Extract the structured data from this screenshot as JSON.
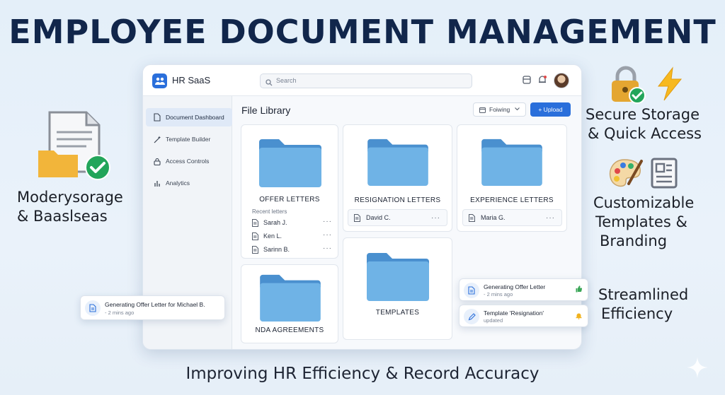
{
  "headline": "EMPLOYEE DOCUMENT MANAGEMENT",
  "footer": "Improving HR Efficiency & Record Accuracy",
  "left_feature": {
    "line1": "Moderysorage",
    "line2": "& Baaslseas"
  },
  "right_features": [
    {
      "line1": "Secure Storage",
      "line2": "& Quick Access"
    },
    {
      "line1": "Customizable",
      "line2": "Templates &",
      "line3": "Branding"
    },
    {
      "line1": "Streamlined",
      "line2": "Efficiency"
    }
  ],
  "app": {
    "name": "HR SaaS",
    "search_placeholder": "Search",
    "sidebar": [
      {
        "label": "Document Dashboard",
        "icon": "document-icon",
        "active": true
      },
      {
        "label": "Template Builder",
        "icon": "wand-icon",
        "active": false
      },
      {
        "label": "Access Controls",
        "icon": "lock-icon",
        "active": false
      },
      {
        "label": "Analytics",
        "icon": "bar-chart-icon",
        "active": false
      }
    ],
    "section_title": "File Library",
    "filter_label": "Foiwing",
    "upload_label": "+ Upload",
    "folders": {
      "offer": {
        "title": "OFFER LETTERS",
        "recent_label": "Recent letters",
        "recent": [
          "Sarah J.",
          "Ken L.",
          "Sarinn B."
        ]
      },
      "resignation": {
        "title": "RESIGNATION LETTERS",
        "file": "David C."
      },
      "experience": {
        "title": "EXPERIENCE LETTERS",
        "file": "Maria G."
      },
      "templates": {
        "title": "TEMPLATES"
      },
      "nda": {
        "title": "NDA AGREEMENTS"
      }
    }
  },
  "toasts": {
    "left": {
      "title": "Generating Offer Letter for Michael B.",
      "time": "- 2 mins ago"
    },
    "right1": {
      "title": "Generating Offer Letter",
      "time": "- 2 mins ago"
    },
    "right2": {
      "title": "Template 'Resignation'",
      "time": "updated"
    }
  },
  "colors": {
    "brand": "#2a6fdb",
    "folder": "#6fb3e6",
    "headline": "#11264b"
  }
}
